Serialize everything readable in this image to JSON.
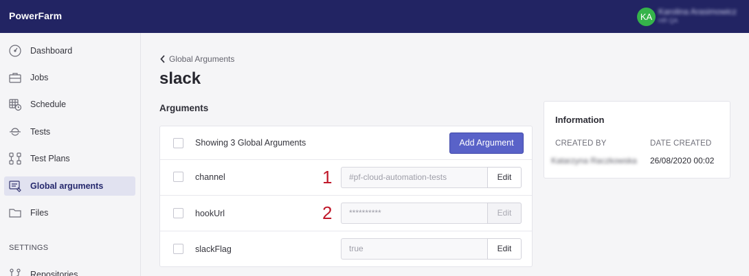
{
  "app": {
    "title": "PowerFarm"
  },
  "user": {
    "initials": "KA",
    "name": "Karolina Arasimowicz",
    "role": "HR QA"
  },
  "sidebar": {
    "items": [
      {
        "label": "Dashboard",
        "icon": "dashboard-icon",
        "active": false
      },
      {
        "label": "Jobs",
        "icon": "briefcase-icon",
        "active": false
      },
      {
        "label": "Schedule",
        "icon": "calendar-clock-icon",
        "active": false
      },
      {
        "label": "Tests",
        "icon": "tests-icon",
        "active": false
      },
      {
        "label": "Test Plans",
        "icon": "flow-icon",
        "active": false
      },
      {
        "label": "Global arguments",
        "icon": "arguments-icon",
        "active": true
      },
      {
        "label": "Files",
        "icon": "folder-icon",
        "active": false
      }
    ],
    "section_label": "SETTINGS",
    "partial_item": {
      "label": "Repositories",
      "icon": "repository-icon"
    }
  },
  "breadcrumb": {
    "label": "Global Arguments"
  },
  "page": {
    "title": "slack",
    "section_title": "Arguments"
  },
  "arguments": {
    "summary": "Showing 3 Global Arguments",
    "add_button": "Add Argument",
    "rows": [
      {
        "name": "channel",
        "value": "#pf-cloud-automation-tests",
        "edit_label": "Edit",
        "edit_disabled": false,
        "annotation": "1"
      },
      {
        "name": "hookUrl",
        "value": "**********",
        "edit_label": "Edit",
        "edit_disabled": true,
        "annotation": "2"
      },
      {
        "name": "slackFlag",
        "value": "true",
        "edit_label": "Edit",
        "edit_disabled": false,
        "annotation": ""
      }
    ]
  },
  "information": {
    "title": "Information",
    "created_by_label": "CREATED BY",
    "created_by_value": "Katarzyna Raczkowska",
    "date_created_label": "DATE CREATED",
    "date_created_value": "26/08/2020 00:02"
  },
  "colors": {
    "topbar": "#222463",
    "accent": "#5962c8",
    "avatar": "#35b34a",
    "annotation": "#c0182a",
    "active_nav": "#e1e2f0"
  }
}
